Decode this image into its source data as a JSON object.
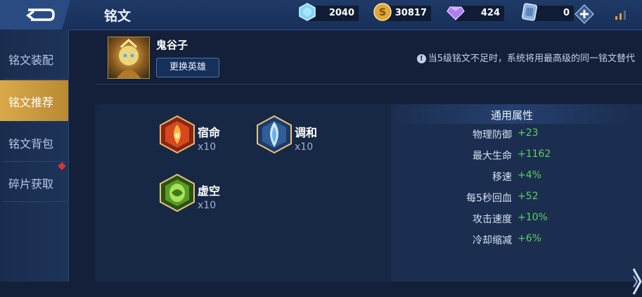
{
  "header": {
    "title": "铭文",
    "currencies": [
      {
        "icon": "diamond-gem-icon",
        "value": "2040"
      },
      {
        "icon": "gold-coin-icon",
        "value": "30817"
      },
      {
        "icon": "purple-crystal-icon",
        "value": "424"
      },
      {
        "icon": "card-voucher-icon",
        "value": "0"
      }
    ]
  },
  "sidebar": {
    "items": [
      {
        "label": "铭文装配"
      },
      {
        "label": "铭文推荐"
      },
      {
        "label": "铭文背包"
      },
      {
        "label": "碎片获取"
      }
    ],
    "active_index": 1
  },
  "hero": {
    "name": "鬼谷子",
    "change_button": "更换英雄"
  },
  "notice": "当5级铭文不足时，系统将用最高级的同一铭文替代",
  "runes": [
    {
      "name": "宿命",
      "count": "x10",
      "color": "red"
    },
    {
      "name": "调和",
      "count": "x10",
      "color": "blue"
    },
    {
      "name": "虚空",
      "count": "x10",
      "color": "green"
    }
  ],
  "attributes": {
    "title": "通用属性",
    "rows": [
      {
        "key": "物理防御",
        "value": "+23"
      },
      {
        "key": "最大生命",
        "value": "+1162"
      },
      {
        "key": "移速",
        "value": "+4%"
      },
      {
        "key": "每5秒回血",
        "value": "+52"
      },
      {
        "key": "攻击速度",
        "value": "+10%"
      },
      {
        "key": "冷却缩减",
        "value": "+6%"
      }
    ]
  },
  "colors": {
    "accent_gold": "#d9a94a",
    "value_green": "#5ccf5c",
    "background": "#14203a"
  }
}
